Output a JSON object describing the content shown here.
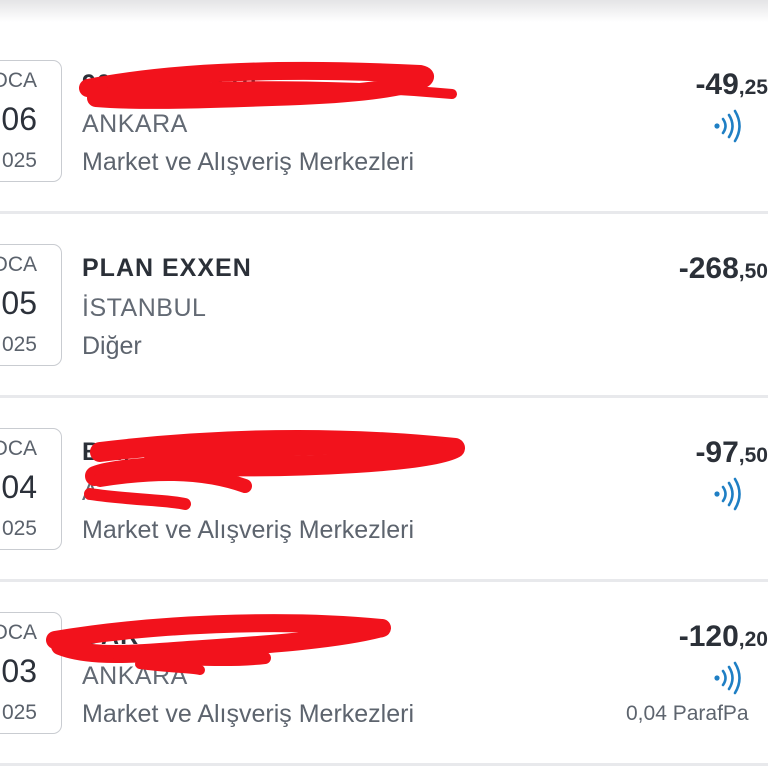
{
  "transactions": [
    {
      "month": "OCA",
      "day": "06",
      "year": "025",
      "merchant": "904SH809A10",
      "city": "ANKARA",
      "category": "Market ve Alışveriş Merkezleri",
      "amount_int": "-49",
      "amount_dec": ",25",
      "contactless": true,
      "contactless_icon": "contactless-icon"
    },
    {
      "month": "OCA",
      "day": "05",
      "year": "025",
      "merchant": "PLAN EXXEN",
      "city": "İSTANBUL",
      "category": "Diğer",
      "amount_int": "-268",
      "amount_dec": ",50",
      "contactless": false
    },
    {
      "month": "OCA",
      "day": "04",
      "year": "025",
      "merchant": "BIM",
      "city": "A",
      "category": "Market ve Alışveriş Merkezleri",
      "amount_int": "-97",
      "amount_dec": ",50",
      "contactless": true,
      "contactless_icon": "contactless-icon"
    },
    {
      "month": "OCA",
      "day": "03",
      "year": "025",
      "merchant": "CAR",
      "city": "ANKARA",
      "category": "Market ve Alışveriş Merkezleri",
      "amount_int": "-120",
      "amount_dec": ",20",
      "contactless": true,
      "contactless_icon": "contactless-icon",
      "points": "0,04 ParafPa"
    }
  ],
  "colors": {
    "text_dark": "#2b3038",
    "text_muted": "#5d646e",
    "contactless_blue": "#1f7fc4",
    "redaction_red": "#f2121c",
    "separator": "#e8e9ec"
  }
}
